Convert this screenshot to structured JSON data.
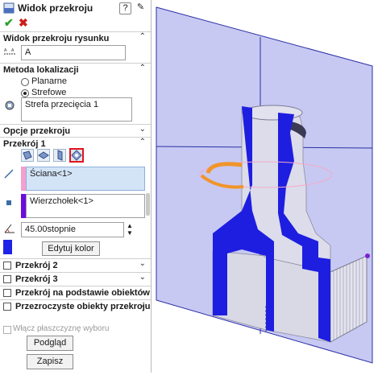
{
  "panel": {
    "title": "Widok przekroju",
    "help_glyph": "?",
    "pin_glyph": "✎"
  },
  "actions": {
    "ok_glyph": "✔",
    "cancel_glyph": "✖"
  },
  "sections": {
    "drawing_section": {
      "label": "Widok przekroju rysunku",
      "value": "A"
    },
    "locate_method": {
      "label": "Metoda lokalizacji",
      "options": [
        "Planarne",
        "Strefowe"
      ],
      "selected": "Strefowe",
      "zone_value": "Strefa przecięcia 1"
    },
    "section_options": {
      "label": "Opcje przekroju"
    },
    "section1": {
      "label": "Przekrój 1",
      "face_value": "Ściana<1>",
      "vertex_value": "Wierzchołek<1>",
      "angle_value": "45.00stopnie",
      "edit_color_label": "Edytuj kolor",
      "color_swatch": "#1f23e6"
    },
    "collapsed": [
      {
        "label": "Przekrój 2"
      },
      {
        "label": "Przekrój 3"
      },
      {
        "label": "Przekrój na podstawie obiektów"
      },
      {
        "label": "Przezroczyste obiekty przekroju"
      }
    ],
    "plane_check_label": "Włącz płaszczyznę wyboru",
    "preview_label": "Podgląd",
    "save_label": "Zapisz"
  },
  "colors": {
    "plane": "#c7c9f2",
    "plane_edge": "#2a2fa5",
    "cut_face": "#1e1ee0",
    "part_gray": "#d9d9e6",
    "ring": "#f0952a",
    "face_highlight": "#f6a8c8",
    "vertex_purple": "#7b1fd6"
  }
}
